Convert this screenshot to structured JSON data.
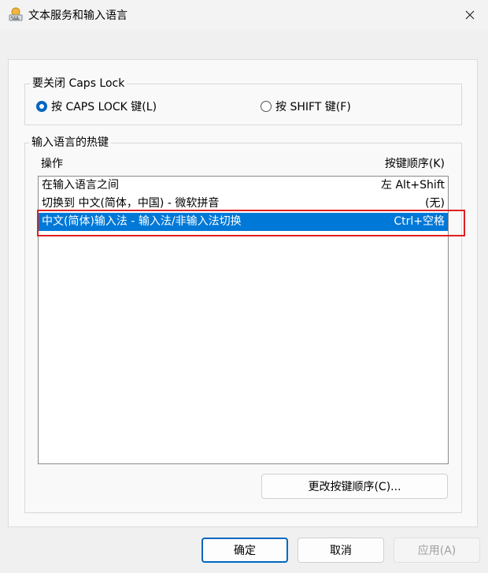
{
  "window": {
    "title": "文本服务和输入语言"
  },
  "caps_lock": {
    "caption": "要关闭 Caps Lock",
    "options": [
      {
        "label": "按 CAPS LOCK 键(L)",
        "checked": true
      },
      {
        "label": "按 SHIFT 键(F)",
        "checked": false
      }
    ]
  },
  "hotkeys": {
    "caption": "输入语言的热键",
    "col_action": "操作",
    "col_keys": "按键顺序(K)",
    "rows": [
      {
        "action": "在输入语言之间",
        "keys": "左 Alt+Shift",
        "selected": false
      },
      {
        "action": "切换到 中文(简体，中国) - 微软拼音",
        "keys": "(无)",
        "selected": false
      },
      {
        "action": "中文(简体)输入法 - 输入法/非输入法切换",
        "keys": "Ctrl+空格",
        "selected": true
      }
    ],
    "change_button": "更改按键顺序(C)..."
  },
  "footer": {
    "ok": "确定",
    "cancel": "取消",
    "apply": "应用(A)"
  },
  "colors": {
    "accent": "#0067c0",
    "selection": "#0078d7",
    "highlight_border": "#e02020"
  }
}
